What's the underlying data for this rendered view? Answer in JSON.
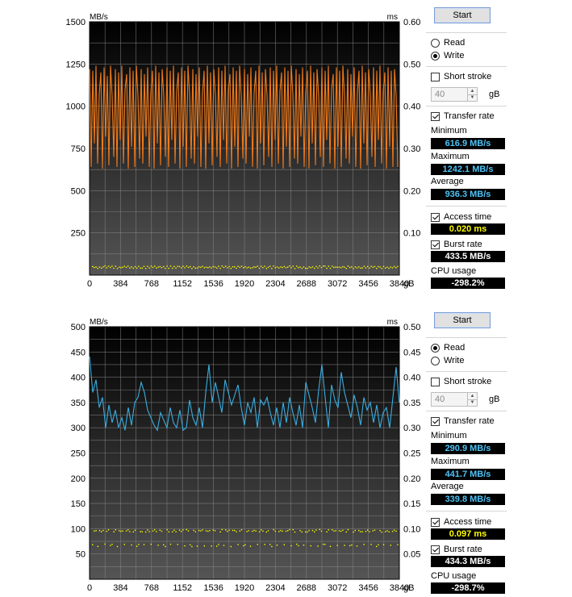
{
  "panels": [
    {
      "mode": "write",
      "start_label": "Start",
      "radio_read": "Read",
      "radio_write": "Write",
      "short_stroke_label": "Short stroke",
      "stroke_value": "40",
      "stroke_unit": "gB",
      "transfer_rate_label": "Transfer rate",
      "minimum_label": "Minimum",
      "minimum_value": "616.9 MB/s",
      "maximum_label": "Maximum",
      "maximum_value": "1242.1 MB/s",
      "average_label": "Average",
      "average_value": "936.3 MB/s",
      "access_time_label": "Access time",
      "access_time_value": "0.020 ms",
      "burst_rate_label": "Burst rate",
      "burst_rate_value": "433.5 MB/s",
      "cpu_usage_label": "CPU usage",
      "cpu_usage_value": "-298.2%",
      "colors": {
        "transfer_line": "#f07a1a",
        "access_dots": "#ffff00",
        "plot_bg_top": "#000000",
        "plot_bg_bottom": "#555555"
      }
    },
    {
      "mode": "read",
      "start_label": "Start",
      "radio_read": "Read",
      "radio_write": "Write",
      "short_stroke_label": "Short stroke",
      "stroke_value": "40",
      "stroke_unit": "gB",
      "transfer_rate_label": "Transfer rate",
      "minimum_label": "Minimum",
      "minimum_value": "290.9 MB/s",
      "maximum_label": "Maximum",
      "maximum_value": "441.7 MB/s",
      "average_label": "Average",
      "average_value": "339.8 MB/s",
      "access_time_label": "Access time",
      "access_time_value": "0.097 ms",
      "burst_rate_label": "Burst rate",
      "burst_rate_value": "434.3 MB/s",
      "cpu_usage_label": "CPU usage",
      "cpu_usage_value": "-298.7%",
      "colors": {
        "transfer_line": "#3aaee0",
        "access_dots": "#ffff00",
        "plot_bg_top": "#000000",
        "plot_bg_bottom": "#555555"
      }
    }
  ],
  "chart_data": [
    {
      "type": "line",
      "y_unit_left": "MB/s",
      "y_unit_right": "ms",
      "x_unit": "gB",
      "x_ticks": [
        "0",
        "384",
        "768",
        "1152",
        "1536",
        "1920",
        "2304",
        "2688",
        "3072",
        "3456",
        "3840"
      ],
      "y_ticks_left": [
        "250",
        "500",
        "750",
        "1000",
        "1250",
        "1500"
      ],
      "y_ticks_right": [
        "0.10",
        "0.20",
        "0.30",
        "0.40",
        "0.50",
        "0.60"
      ],
      "xlim": [
        0,
        3840
      ],
      "ylim_left": [
        0,
        1500
      ],
      "ylim_right": [
        0,
        0.6
      ],
      "grid": true,
      "series": [
        {
          "values_x": [
            0,
            20,
            40,
            60,
            80,
            100,
            120,
            140,
            160,
            180,
            200,
            220,
            240,
            260,
            280,
            300,
            320,
            340,
            360,
            380,
            400,
            420,
            440,
            460,
            480,
            500,
            520,
            540,
            560,
            580,
            600,
            620,
            640,
            660,
            680,
            700,
            720,
            740,
            760,
            780,
            800,
            820,
            840,
            860,
            880,
            900,
            920,
            940,
            960,
            980,
            1000,
            1020,
            1040,
            1060,
            1080,
            1100,
            1120,
            1140,
            1160,
            1180,
            1200,
            1220,
            1240,
            1260,
            1280,
            1300,
            1320,
            1340,
            1360,
            1380,
            1400,
            1420,
            1440,
            1460,
            1480,
            1500,
            1520,
            1540,
            1560,
            1580,
            1600,
            1620,
            1640,
            1660,
            1680,
            1700,
            1720,
            1740,
            1760,
            1780,
            1800,
            1820,
            1840,
            1860,
            1880,
            1900,
            1920,
            1940,
            1960,
            1980,
            2000,
            2020,
            2040,
            2060,
            2080,
            2100,
            2120,
            2140,
            2160,
            2180,
            2200,
            2220,
            2240,
            2260,
            2280,
            2300,
            2320,
            2340,
            2360,
            2380,
            2400,
            2420,
            2440,
            2460,
            2480,
            2500,
            2520,
            2540,
            2560,
            2580,
            2600,
            2620,
            2640,
            2660,
            2680,
            2700,
            2720,
            2740,
            2760,
            2780,
            2800,
            2820,
            2840,
            2860,
            2880,
            2900,
            2920,
            2940,
            2960,
            2980,
            3000,
            3020,
            3040,
            3060,
            3080,
            3100,
            3120,
            3140,
            3160,
            3180,
            3200,
            3220,
            3240,
            3260,
            3280,
            3300,
            3320,
            3340,
            3360,
            3380,
            3400,
            3420,
            3440,
            3460,
            3480,
            3500,
            3520,
            3540,
            3560,
            3580,
            3600,
            3620,
            3640,
            3660,
            3680,
            3700,
            3720,
            3740,
            3760,
            3780,
            3800,
            3820,
            3840
          ],
          "values_y": [
            1220,
            640,
            1210,
            780,
            1240,
            660,
            1070,
            1200,
            630,
            1230,
            820,
            1180,
            650,
            1240,
            1060,
            700,
            1220,
            640,
            1200,
            800,
            1240,
            660,
            1100,
            1190,
            630,
            1230,
            760,
            1210,
            640,
            1240,
            1060,
            690,
            1220,
            660,
            1190,
            820,
            1230,
            640,
            1080,
            1210,
            630,
            1240,
            780,
            1200,
            650,
            1220,
            1060,
            700,
            1230,
            640,
            1210,
            800,
            1240,
            660,
            1090,
            1200,
            630,
            1230,
            760,
            1210,
            640,
            1240,
            1070,
            690,
            1220,
            660,
            1190,
            820,
            1230,
            640,
            1080,
            1210,
            630,
            1240,
            780,
            1200,
            650,
            1220,
            1060,
            700,
            1230,
            640,
            1210,
            800,
            1240,
            660,
            1100,
            1190,
            630,
            1230,
            760,
            1210,
            640,
            1240,
            1060,
            690,
            1220,
            660,
            1190,
            820,
            1230,
            640,
            1080,
            1210,
            630,
            1240,
            780,
            1200,
            650,
            1220,
            1060,
            700,
            1230,
            640,
            1210,
            800,
            1240,
            660,
            1090,
            1200,
            630,
            1230,
            760,
            1210,
            640,
            1240,
            1070,
            690,
            1220,
            660,
            1190,
            820,
            1230,
            640,
            1080,
            1210,
            630,
            1240,
            780,
            1200,
            650,
            1220,
            1060,
            700,
            1230,
            640,
            1210,
            800,
            1240,
            660,
            1100,
            1190,
            630,
            1230,
            760,
            1210,
            640,
            1240,
            1060,
            690,
            1220,
            660,
            1190,
            820,
            1230,
            640,
            1080,
            1210,
            630,
            1240,
            780,
            1200,
            650,
            1220,
            1060,
            700,
            1230,
            640,
            1210,
            800,
            1240,
            660,
            1090,
            1200,
            630,
            1230,
            760,
            1210,
            640,
            1220,
            1060,
            640
          ]
        }
      ],
      "access_time_ms": 0.02
    },
    {
      "type": "line",
      "y_unit_left": "MB/s",
      "y_unit_right": "ms",
      "x_unit": "gB",
      "x_ticks": [
        "0",
        "384",
        "768",
        "1152",
        "1536",
        "1920",
        "2304",
        "2688",
        "3072",
        "3456",
        "3840"
      ],
      "y_ticks_left": [
        "50",
        "100",
        "150",
        "200",
        "250",
        "300",
        "350",
        "400",
        "450",
        "500"
      ],
      "y_ticks_right": [
        "0.05",
        "0.10",
        "0.15",
        "0.20",
        "0.25",
        "0.30",
        "0.35",
        "0.40",
        "0.45",
        "0.50"
      ],
      "xlim": [
        0,
        3840
      ],
      "ylim_left": [
        0,
        500
      ],
      "ylim_right": [
        0,
        0.5
      ],
      "grid": true,
      "series": [
        {
          "values_x": [
            0,
            40,
            80,
            120,
            160,
            200,
            240,
            280,
            320,
            360,
            400,
            440,
            480,
            520,
            560,
            600,
            640,
            680,
            720,
            760,
            800,
            840,
            880,
            920,
            960,
            1000,
            1040,
            1080,
            1120,
            1160,
            1200,
            1240,
            1280,
            1320,
            1360,
            1400,
            1440,
            1480,
            1520,
            1560,
            1600,
            1640,
            1680,
            1720,
            1760,
            1800,
            1840,
            1880,
            1920,
            1960,
            2000,
            2040,
            2080,
            2120,
            2160,
            2200,
            2240,
            2280,
            2320,
            2360,
            2400,
            2440,
            2480,
            2520,
            2560,
            2600,
            2640,
            2680,
            2720,
            2760,
            2800,
            2840,
            2880,
            2920,
            2960,
            3000,
            3040,
            3080,
            3120,
            3160,
            3200,
            3240,
            3280,
            3320,
            3360,
            3400,
            3440,
            3480,
            3520,
            3560,
            3600,
            3640,
            3680,
            3720,
            3760,
            3800,
            3840
          ],
          "values_y": [
            441,
            370,
            395,
            340,
            360,
            300,
            345,
            310,
            335,
            300,
            320,
            295,
            340,
            305,
            350,
            360,
            390,
            370,
            335,
            320,
            305,
            295,
            330,
            315,
            300,
            340,
            310,
            300,
            335,
            295,
            300,
            355,
            320,
            305,
            340,
            300,
            370,
            425,
            350,
            390,
            360,
            330,
            395,
            370,
            345,
            365,
            385,
            340,
            305,
            350,
            330,
            360,
            300,
            355,
            345,
            360,
            330,
            305,
            340,
            300,
            350,
            310,
            360,
            330,
            305,
            345,
            300,
            390,
            365,
            340,
            310,
            375,
            425,
            360,
            300,
            385,
            355,
            340,
            410,
            370,
            345,
            320,
            365,
            340,
            305,
            360,
            335,
            350,
            310,
            345,
            300,
            330,
            340,
            300,
            360,
            420,
            350,
            375,
            345,
            370,
            360,
            365
          ]
        }
      ],
      "access_time_ms": 0.097
    }
  ]
}
